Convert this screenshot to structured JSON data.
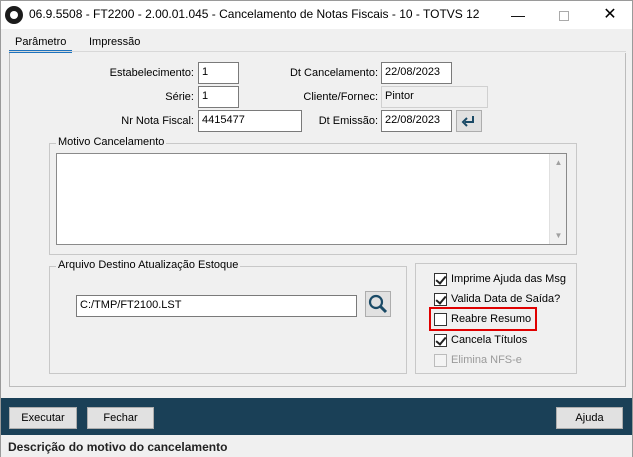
{
  "window": {
    "title": "06.9.5508 - FT2200 - 2.00.01.045 - Cancelamento de Notas Fiscais - 10 - TOTVS 12",
    "minimize": "—",
    "close": "✕"
  },
  "tabs": [
    {
      "label": "Parâmetro",
      "active": true
    },
    {
      "label": "Impressão",
      "active": false
    }
  ],
  "fields": {
    "estabelecimento": {
      "label": "Estabelecimento:",
      "value": "1"
    },
    "serie": {
      "label": "Série:",
      "value": "1"
    },
    "nr_nota_fiscal": {
      "label": "Nr Nota Fiscal:",
      "value": "4415477"
    },
    "dt_cancelamento": {
      "label": "Dt Cancelamento:",
      "value": "22/08/2023"
    },
    "cliente_fornec": {
      "label": "Cliente/Fornec:",
      "value": "Pintor"
    },
    "dt_emissao": {
      "label": "Dt Emissão:",
      "value": "22/08/2023"
    }
  },
  "motivo": {
    "title": "Motivo Cancelamento",
    "value": ""
  },
  "arquivo": {
    "title": "Arquivo Destino Atualização Estoque",
    "value": "C:/TMP/FT2100.LST"
  },
  "options": [
    {
      "label": "Imprime Ajuda das Msg",
      "checked": true,
      "enabled": true
    },
    {
      "label": "Valida Data de Saída?",
      "checked": true,
      "enabled": true
    },
    {
      "label": "Reabre Resumo",
      "checked": false,
      "enabled": true
    },
    {
      "label": "Cancela Títulos",
      "checked": true,
      "enabled": true
    },
    {
      "label": "Elimina NFS-e",
      "checked": false,
      "enabled": false
    }
  ],
  "buttons": {
    "executar": "Executar",
    "fechar": "Fechar",
    "ajuda": "Ajuda"
  },
  "status_text": "Descrição do motivo do cancelamento",
  "colors": {
    "bottom_bar": "#1a4057",
    "highlight": "#e00000",
    "tab_accent": "#1e73be"
  }
}
